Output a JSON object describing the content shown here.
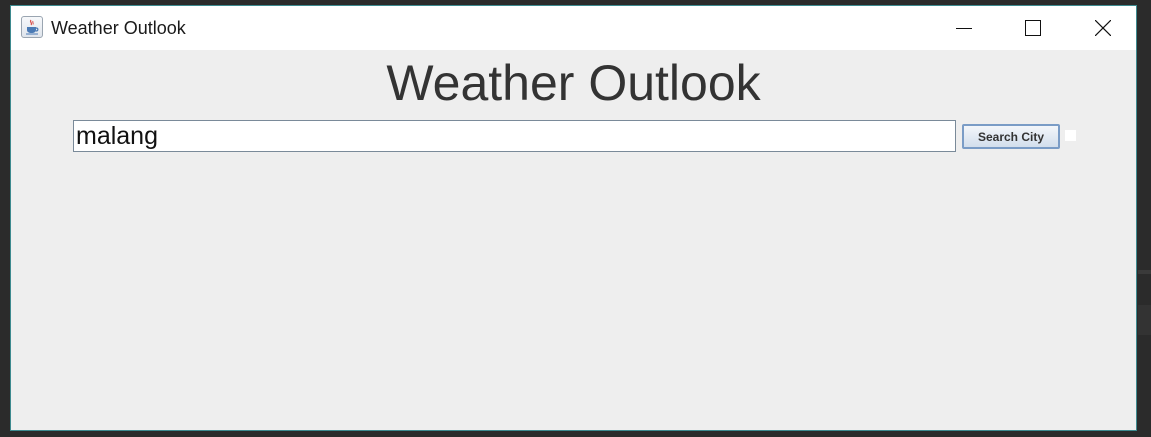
{
  "window": {
    "title": "Weather Outlook",
    "controls": {
      "minimize": "minimize-icon",
      "maximize": "maximize-icon",
      "close": "close-icon"
    },
    "icon": "java-cup-icon"
  },
  "main": {
    "heading": "Weather Outlook",
    "search": {
      "value": "malang",
      "placeholder": ""
    },
    "search_button_label": "Search City"
  },
  "colors": {
    "window_background": "#eeeeee",
    "titlebar": "#ffffff",
    "window_border": "#3d8a8f",
    "heading_text": "#333333",
    "button_border": "#7a9cc6"
  }
}
